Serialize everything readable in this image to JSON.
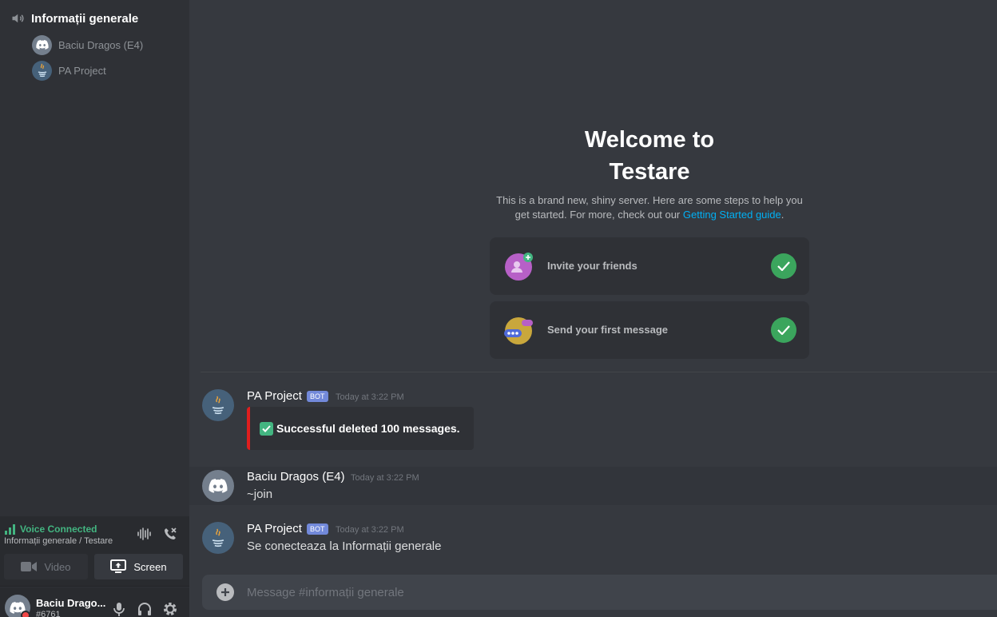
{
  "sidebar": {
    "voice_channel": "Informații generale",
    "members": [
      {
        "name": "Baciu Dragos (E4)",
        "avatar": "discord-logo-icon"
      },
      {
        "name": "PA Project",
        "avatar": "java-logo-icon"
      }
    ]
  },
  "voice": {
    "status": "Voice Connected",
    "location": "Informații generale / Testare",
    "video_label": "Video",
    "screen_label": "Screen"
  },
  "user": {
    "name": "Baciu Drago...",
    "tag": "#6761"
  },
  "welcome": {
    "title_line1": "Welcome to",
    "title_line2": "Testare",
    "desc": "This is a brand new, shiny server. Here are some steps to help you get started. For more, check out our",
    "link": "Getting Started guide",
    "desc_end": ".",
    "cards": [
      {
        "label": "Invite your friends",
        "icon": "invite-friends-icon",
        "done": true
      },
      {
        "label": "Send your first message",
        "icon": "send-message-icon",
        "done": true
      }
    ]
  },
  "messages": [
    {
      "author": "PA Project",
      "bot": "BOT",
      "time": "Today at 3:22 PM",
      "embed": "Successful deleted 100 messages."
    },
    {
      "author": "Baciu Dragos (E4)",
      "time": "Today at 3:22 PM",
      "text": "~join"
    },
    {
      "author": "PA Project",
      "bot": "BOT",
      "time": "Today at 3:22 PM",
      "text": "Se conecteaza la Informații generale"
    }
  ],
  "composer": {
    "placeholder": "Message #informații generale"
  },
  "colors": {
    "accent_green": "#43b581",
    "bot_badge": "#7289da",
    "link": "#00b0f4",
    "embed_border": "#e01e1e"
  }
}
